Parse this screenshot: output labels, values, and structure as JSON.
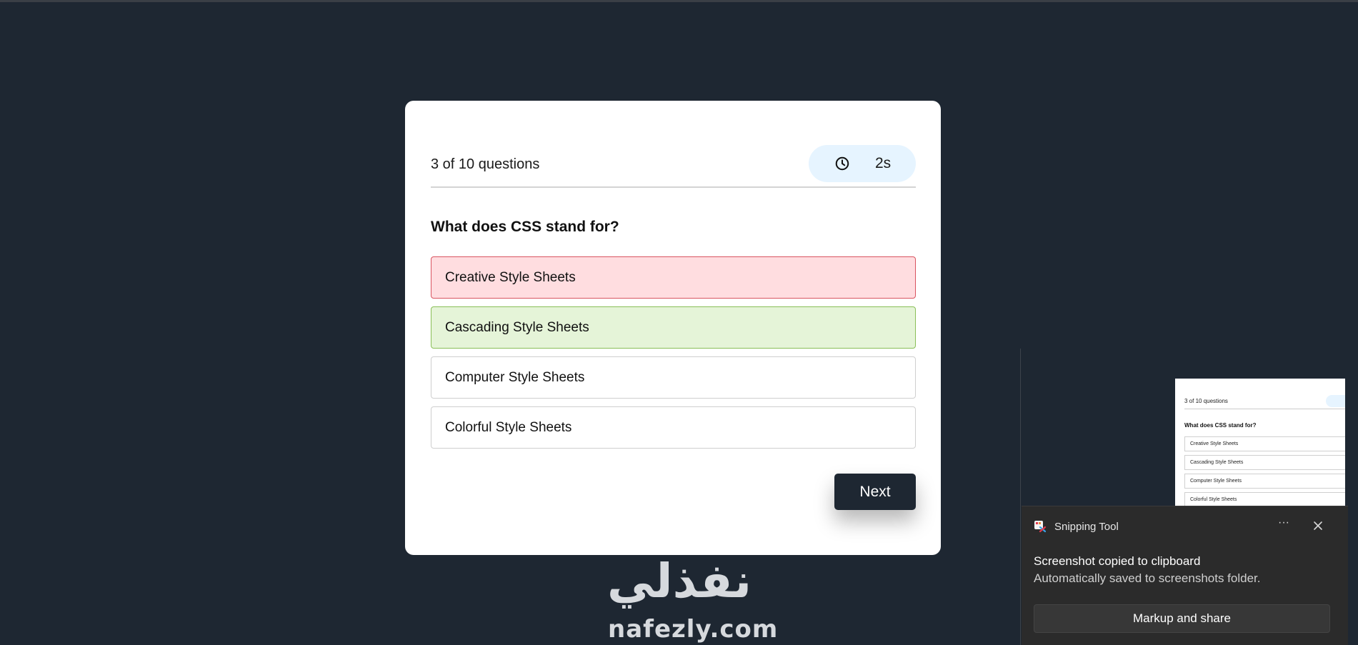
{
  "quiz": {
    "progress_text": "3 of 10 questions",
    "timer": {
      "icon": "clock-icon",
      "value": "2s"
    },
    "question": "What does CSS stand for?",
    "options": [
      {
        "label": "Creative Style Sheets",
        "state": "wrong"
      },
      {
        "label": "Cascading Style Sheets",
        "state": "correct"
      },
      {
        "label": "Computer Style Sheets",
        "state": "default"
      },
      {
        "label": "Colorful Style Sheets",
        "state": "default"
      }
    ],
    "next_label": "Next"
  },
  "watermark": {
    "arabic": "نفذلي",
    "latin": "nafezly.com"
  },
  "thumbnail": {
    "progress_text": "3 of 10 questions",
    "question": "What does CSS stand for?",
    "options": [
      "Creative Style Sheets",
      "Cascading Style Sheets",
      "Computer Style Sheets",
      "Colorful Style Sheets"
    ]
  },
  "toast": {
    "app_name": "Snipping Tool",
    "more_icon": "ellipsis-icon",
    "close_icon": "close-icon",
    "title": "Screenshot copied to clipboard",
    "body": "Automatically saved to screenshots folder.",
    "action_label": "Markup and share"
  },
  "colors": {
    "background": "#1e2732",
    "wrong_bg": "#ffdde0",
    "wrong_border": "#d9535f",
    "correct_bg": "#e5f4d8",
    "correct_border": "#89bf57",
    "timer_bg": "#e6f4ff"
  }
}
